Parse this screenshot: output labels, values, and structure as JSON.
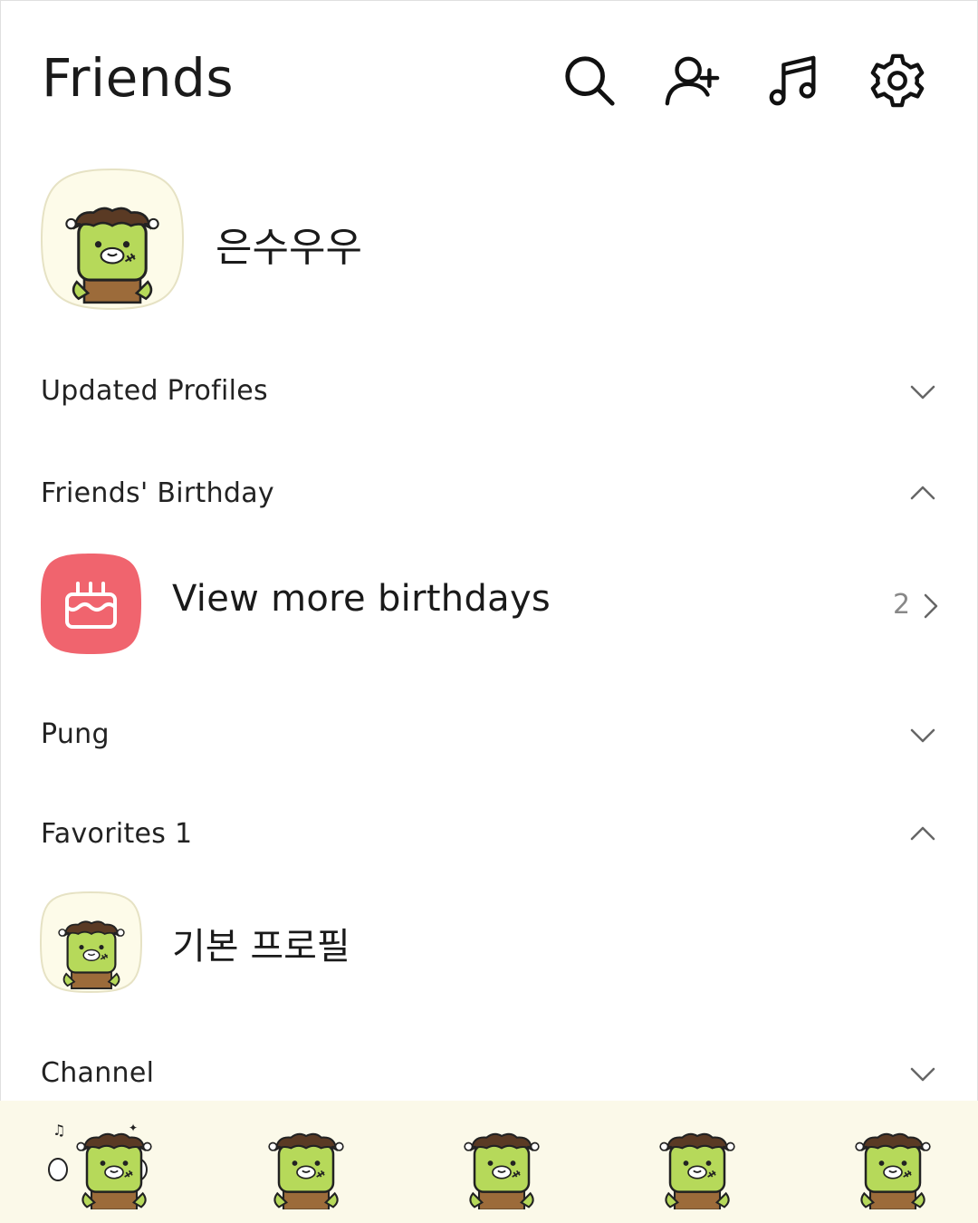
{
  "header": {
    "title": "Friends",
    "icons": [
      "search-icon",
      "add-friend-icon",
      "music-icon",
      "settings-icon"
    ]
  },
  "my_profile": {
    "name": "은수우우"
  },
  "sections": {
    "updated_profiles": {
      "label": "Updated Profiles",
      "state": "collapsed"
    },
    "friends_birthday": {
      "label": "Friends' Birthday",
      "state": "expanded"
    },
    "pung": {
      "label": "Pung",
      "state": "collapsed"
    },
    "favorites": {
      "label": "Favorites 1",
      "state": "expanded"
    },
    "channel": {
      "label": "Channel",
      "state": "collapsed"
    }
  },
  "birthday": {
    "label": "View more birthdays",
    "count": "2"
  },
  "favorites": {
    "items": [
      {
        "name": "기본 프로필"
      }
    ]
  },
  "tabbar": {
    "tabs": [
      "friends-tab",
      "chats-tab",
      "view-tab",
      "shopping-tab",
      "more-tab"
    ],
    "active": "friends-tab"
  },
  "colors": {
    "accent_birthday": "#f0646e",
    "character_green": "#b6d95a",
    "tabbar_bg": "#fbf9e9"
  }
}
